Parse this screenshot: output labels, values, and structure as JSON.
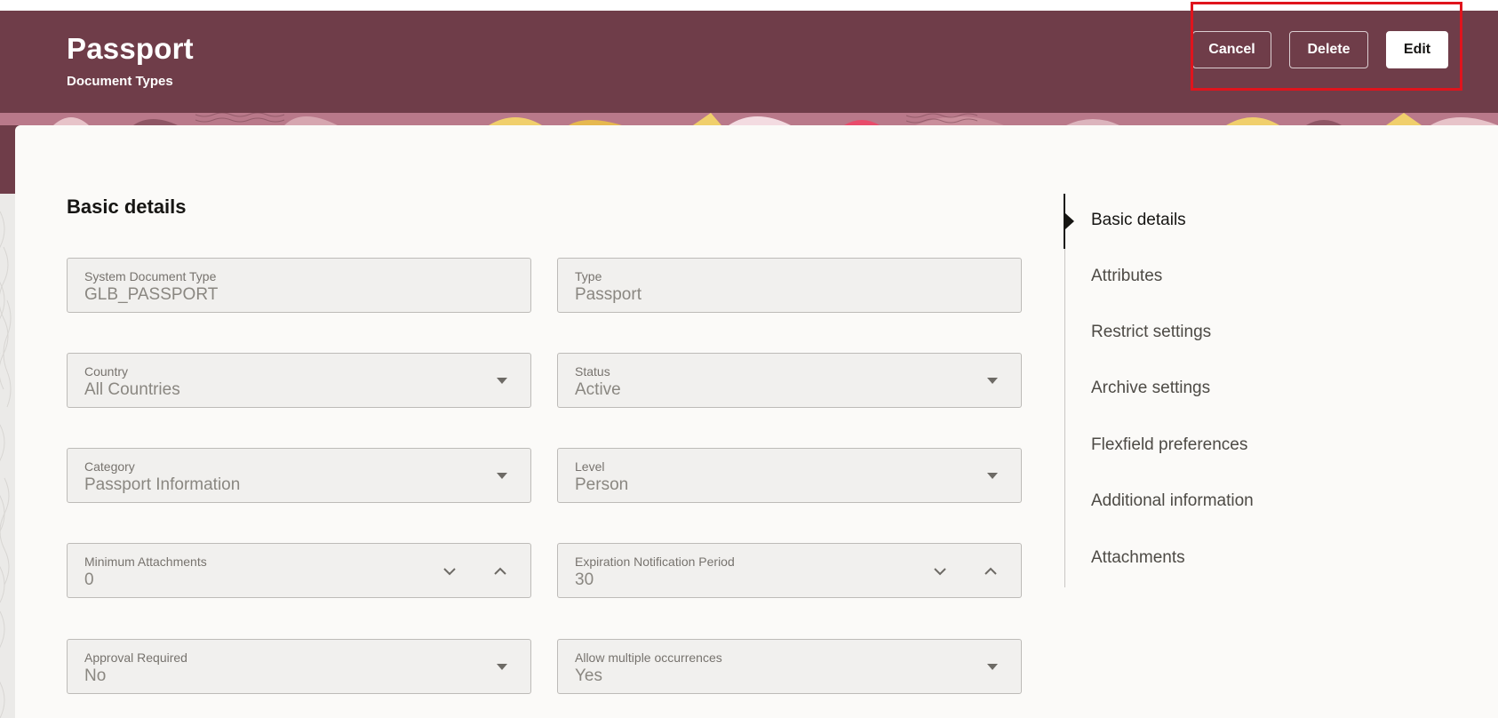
{
  "header": {
    "title": "Passport",
    "subtitle": "Document Types",
    "buttons": {
      "cancel": "Cancel",
      "delete": "Delete",
      "edit": "Edit"
    }
  },
  "section": {
    "title": "Basic details"
  },
  "fields": {
    "system_document_type": {
      "label": "System Document Type",
      "value": "GLB_PASSPORT"
    },
    "type": {
      "label": "Type",
      "value": "Passport"
    },
    "country": {
      "label": "Country",
      "value": "All Countries"
    },
    "status": {
      "label": "Status",
      "value": "Active"
    },
    "category": {
      "label": "Category",
      "value": "Passport Information"
    },
    "level": {
      "label": "Level",
      "value": "Person"
    },
    "minimum_attachments": {
      "label": "Minimum Attachments",
      "value": "0"
    },
    "expiration_notification_period": {
      "label": "Expiration Notification Period",
      "value": "30"
    },
    "approval_required": {
      "label": "Approval Required",
      "value": "No"
    },
    "allow_multiple_occurrences": {
      "label": "Allow multiple occurrences",
      "value": "Yes"
    }
  },
  "nav": {
    "items": [
      {
        "label": "Basic details",
        "active": true
      },
      {
        "label": "Attributes",
        "active": false
      },
      {
        "label": "Restrict settings",
        "active": false
      },
      {
        "label": "Archive settings",
        "active": false
      },
      {
        "label": "Flexfield preferences",
        "active": false
      },
      {
        "label": "Additional information",
        "active": false
      },
      {
        "label": "Attachments",
        "active": false
      }
    ]
  },
  "colors": {
    "header_bg": "#6f3d49",
    "highlight_border": "#e0141d",
    "card_bg": "#fbfaf8",
    "field_bg": "#f1f0ee"
  },
  "icons": {
    "select": "chevron-down-icon",
    "stepper_decrement": "chevron-down-icon",
    "stepper_increment": "chevron-up-icon",
    "nav_active": "triangle-right-icon"
  }
}
